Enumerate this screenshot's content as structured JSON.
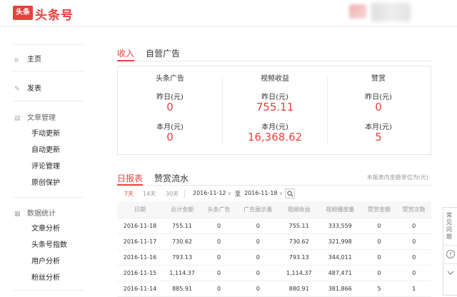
{
  "header": {
    "logo_badge": "头条",
    "logo_text": "头条号"
  },
  "sidebar": {
    "home": "主页",
    "publish": "发表",
    "article_mgmt": "文章管理",
    "article_items": [
      "手动更新",
      "自动更新",
      "评论管理",
      "原创保护"
    ],
    "data_stats": "数据统计",
    "stats_items": [
      "文章分析",
      "头条号指数",
      "用户分析",
      "粉丝分析"
    ]
  },
  "top_tabs": [
    "收入",
    "自营广告"
  ],
  "income": [
    {
      "title": "头条广告",
      "yesterday_label": "昨日(元)",
      "yesterday": "0",
      "month_label": "本月(元)",
      "month": "0"
    },
    {
      "title": "视频收益",
      "yesterday_label": "昨日(元)",
      "yesterday": "755.11",
      "month_label": "本月(元)",
      "month": "16,368.62"
    },
    {
      "title": "赞赏",
      "yesterday_label": "昨日(元)",
      "yesterday": "0",
      "month_label": "本月(元)",
      "month": "5"
    }
  ],
  "report_tabs": [
    "日报表",
    "赞赏流水"
  ],
  "unit_note": "本报表内金额单位为(元)",
  "filters": {
    "ranges": [
      "7天",
      "14天",
      "30天"
    ],
    "start_date": "2016-11-12",
    "to": "至",
    "end_date": "2016-11-18"
  },
  "table": {
    "headers": [
      "日期",
      "总计金额",
      "头条广告",
      "广告展示量",
      "视频收益",
      "视频播放量",
      "赞赏金额",
      "赞赏次数"
    ],
    "rows": [
      [
        "2016-11-18",
        "755.11",
        "0",
        "0",
        "755.11",
        "333,559",
        "0",
        "0"
      ],
      [
        "2016-11-17",
        "730.62",
        "0",
        "0",
        "730.62",
        "321,998",
        "0",
        "0"
      ],
      [
        "2016-11-16",
        "793.13",
        "0",
        "0",
        "793.13",
        "344,011",
        "0",
        "0"
      ],
      [
        "2016-11-15",
        "1,114.37",
        "0",
        "0",
        "1,114.37",
        "487,471",
        "0",
        "0"
      ],
      [
        "2016-11-14",
        "885.91",
        "0",
        "0",
        "880.91",
        "381,866",
        "5",
        "1"
      ]
    ]
  },
  "float_panel": {
    "faq": "常见问题"
  }
}
